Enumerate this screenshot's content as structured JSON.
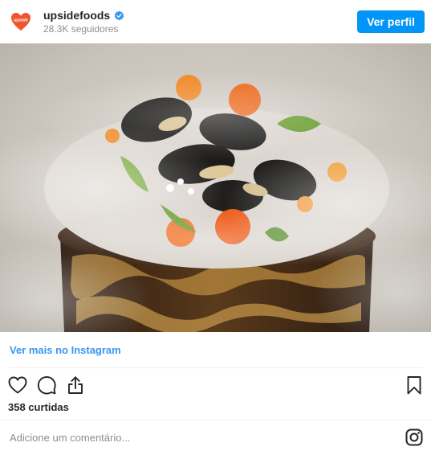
{
  "header": {
    "avatar_text": "upside",
    "username": "upsidefoods",
    "followers": "28.3K seguidores",
    "profile_button": "Ver perfil",
    "verified_icon": "verified-badge-icon"
  },
  "post": {
    "more_link": "Ver mais no Instagram",
    "likes": "358 curtidas",
    "comment_placeholder": "Adicione um comentário..."
  },
  "icons": {
    "like": "heart-icon",
    "comment": "comment-icon",
    "share": "share-icon",
    "save": "bookmark-icon",
    "brand": "instagram-icon"
  },
  "colors": {
    "accent": "#0095f6",
    "link": "#3897f0",
    "avatar": "#f0552e"
  }
}
